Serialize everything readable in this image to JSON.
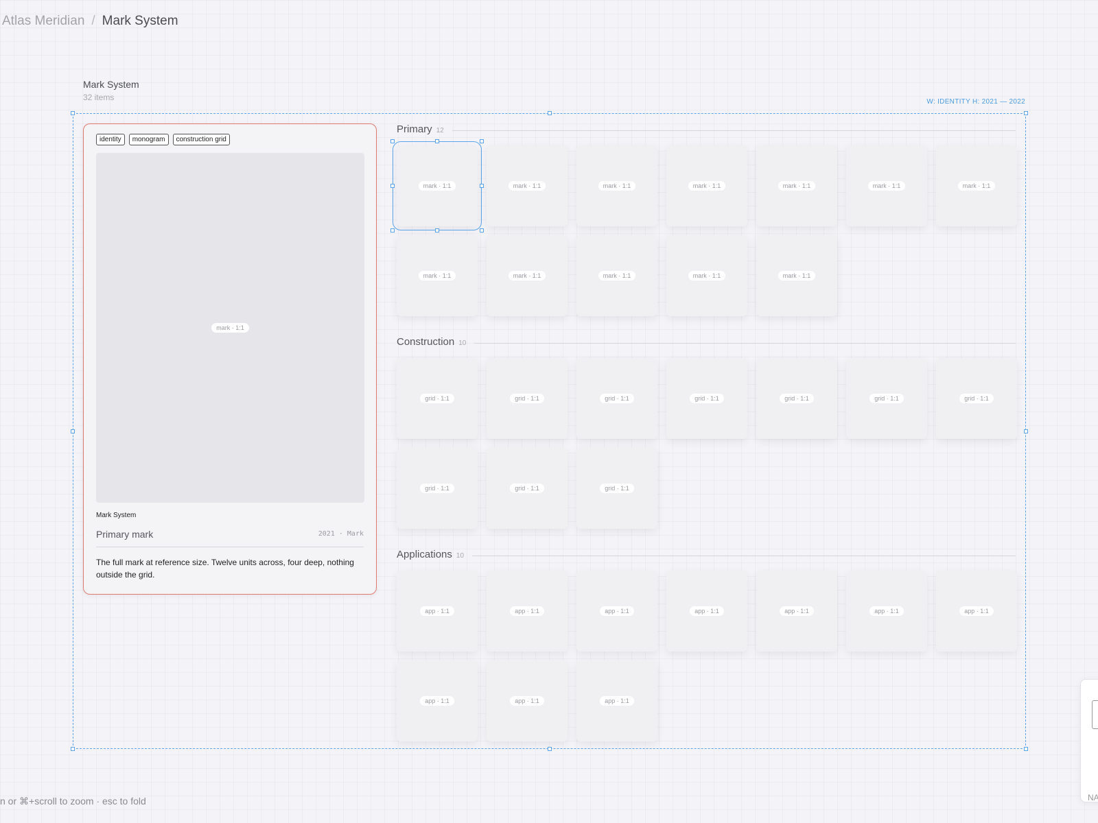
{
  "breadcrumb": {
    "parent": "Atlas Meridian",
    "separator": "/",
    "current": "Mark System"
  },
  "group": {
    "title": "Mark System",
    "count": "32 items",
    "range_label": "W: IDENTITY H: 2021 — 2022"
  },
  "detail": {
    "tags": [
      "identity",
      "monogram",
      "construction grid"
    ],
    "preview_label": "mark · 1:1",
    "collection": "Mark System",
    "title": "Primary mark",
    "meta": "2021 · Mark",
    "description": "The full mark at reference size. Twelve units across, four deep, nothing outside the grid."
  },
  "sections": [
    {
      "title": "Primary",
      "count": "12",
      "thumb_label": "mark · 1:1",
      "items": 12
    },
    {
      "title": "Construction",
      "count": "10",
      "thumb_label": "grid · 1:1",
      "items": 10
    },
    {
      "title": "Applications",
      "count": "10",
      "thumb_label": "app · 1:1",
      "items": 10
    }
  ],
  "footer_hint": "n or ⌘+scroll to zoom · esc to fold",
  "side_widget_label": "NA",
  "colors": {
    "accent": "#5aa3e8",
    "card_border": "#df7a70"
  }
}
